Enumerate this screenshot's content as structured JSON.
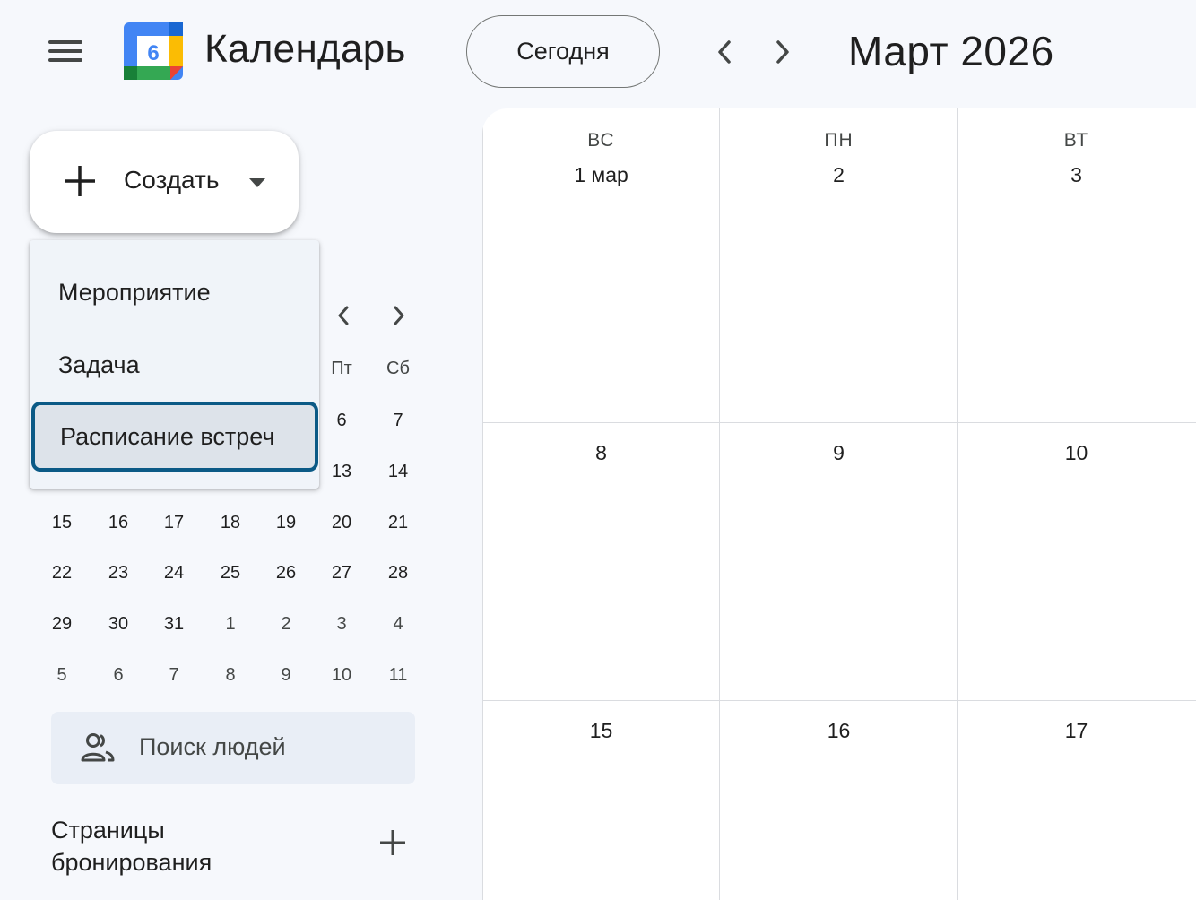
{
  "header": {
    "app_title": "Календарь",
    "logo_day": "6",
    "today_label": "Сегодня",
    "month_title": "Март 2026",
    "icons": [
      "menu-icon",
      "calendar-logo",
      "chevron-left-icon",
      "chevron-right-icon"
    ]
  },
  "create": {
    "label": "Создать",
    "menu_items": [
      "Мероприятие",
      "Задача",
      "Расписание встреч"
    ],
    "focused_item": "Расписание встреч"
  },
  "mini_calendar": {
    "weekday_headers_visible": [
      "Пт",
      "Сб"
    ],
    "partial_rows": [
      [
        "6",
        "7"
      ],
      [
        "13",
        "14"
      ]
    ],
    "rows": [
      [
        "15",
        "16",
        "17",
        "18",
        "19",
        "20",
        "21"
      ],
      [
        "22",
        "23",
        "24",
        "25",
        "26",
        "27",
        "28"
      ],
      [
        "29",
        "30",
        "31",
        "1",
        "2",
        "3",
        "4"
      ],
      [
        "5",
        "6",
        "7",
        "8",
        "9",
        "10",
        "11"
      ]
    ]
  },
  "people_search": {
    "placeholder": "Поиск людей"
  },
  "booking_pages": {
    "title": "Страницы бронирования"
  },
  "main_grid": {
    "weekdays": [
      "ВС",
      "ПН",
      "ВТ"
    ],
    "weeks": [
      [
        "1 мар",
        "2",
        "3"
      ],
      [
        "8",
        "9",
        "10"
      ],
      [
        "15",
        "16",
        "17"
      ]
    ]
  },
  "colors": {
    "background": "#f6f8fc",
    "focus_ring": "#0b5a86",
    "menu_bg": "#f0f4f9",
    "logo_blue": "#4285f4",
    "logo_green": "#34a853",
    "logo_yellow": "#fbbc04",
    "logo_red": "#ea4335"
  }
}
